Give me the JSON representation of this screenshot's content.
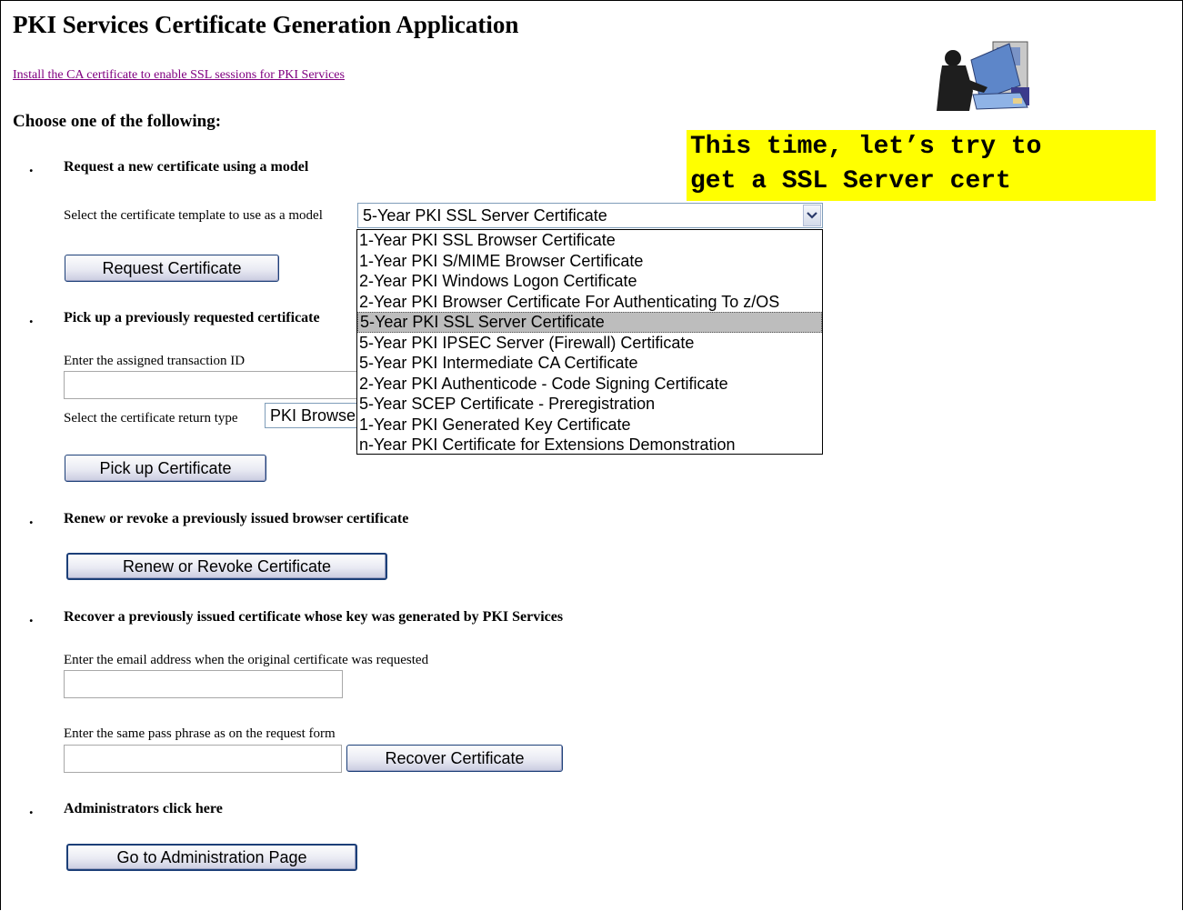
{
  "page": {
    "title": "PKI Services Certificate Generation Application",
    "ca_link": "Install the CA certificate to enable SSL sessions for PKI Services",
    "choose_heading": "Choose one of the following:"
  },
  "callout": {
    "line1": "This time, let’s try to",
    "line2": "get a SSL Server cert"
  },
  "request": {
    "heading": "Request a new certificate using a model",
    "template_label": "Select the certificate template to use as a model",
    "selected_template": "5-Year PKI SSL Server Certificate",
    "button": "Request Certificate",
    "options": [
      "1-Year PKI SSL Browser Certificate",
      "1-Year PKI S/MIME Browser Certificate",
      "2-Year PKI Windows Logon Certificate",
      "2-Year PKI Browser Certificate For Authenticating To z/OS",
      "5-Year PKI SSL Server Certificate",
      "5-Year PKI IPSEC Server (Firewall) Certificate",
      "5-Year PKI Intermediate CA Certificate",
      "2-Year PKI Authenticode - Code Signing Certificate",
      "5-Year SCEP Certificate - Preregistration",
      "1-Year PKI Generated Key Certificate",
      "n-Year PKI Certificate for Extensions Demonstration"
    ]
  },
  "pickup": {
    "heading": "Pick up a previously requested certificate",
    "txid_label": "Enter the assigned transaction ID",
    "txid_value": "",
    "return_type_label": "Select the certificate return type",
    "return_type_value": "PKI Browse",
    "button": "Pick up Certificate"
  },
  "renew": {
    "heading": "Renew or revoke a previously issued browser certificate",
    "button": "Renew or Revoke Certificate"
  },
  "recover": {
    "heading": "Recover a previously issued certificate whose key was generated by PKI Services",
    "email_label": "Enter the email address when the original certificate was requested",
    "email_value": "",
    "passphrase_label": "Enter the same pass phrase as on the request form",
    "passphrase_value": "",
    "button": "Recover Certificate"
  },
  "admin": {
    "heading": "Administrators click here",
    "button": "Go to Administration Page"
  },
  "icons": {
    "user_at_computer": "user-at-computer-icon",
    "dropdown_arrow": "chevron-down-icon",
    "bullet": "bullet-icon"
  }
}
